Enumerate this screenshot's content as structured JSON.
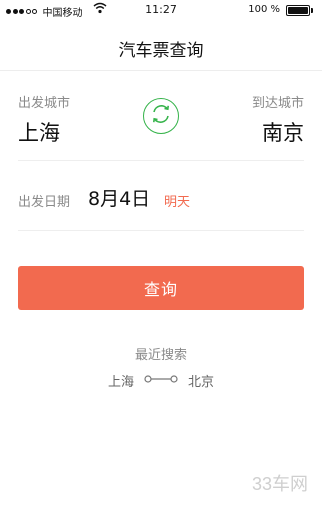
{
  "status_bar": {
    "carrier": "中国移动",
    "time": "11:27",
    "battery": "100 %",
    "signal_filled": 3,
    "signal_total": 5
  },
  "nav": {
    "title": "汽车票查询"
  },
  "route": {
    "from_label": "出发城市",
    "from_city": "上海",
    "to_label": "到达城市",
    "to_city": "南京"
  },
  "date": {
    "label": "出发日期",
    "value": "8月4日",
    "tag": "明天"
  },
  "query_button": {
    "label": "查询"
  },
  "recent": {
    "title": "最近搜索",
    "items": [
      {
        "from": "上海",
        "to": "北京"
      }
    ]
  },
  "watermark": "33车网",
  "colors": {
    "accent": "#f26a4f",
    "swap_green": "#35b34a"
  },
  "icons": [
    "wifi-icon",
    "battery-icon",
    "swap-icon",
    "route-icon"
  ]
}
